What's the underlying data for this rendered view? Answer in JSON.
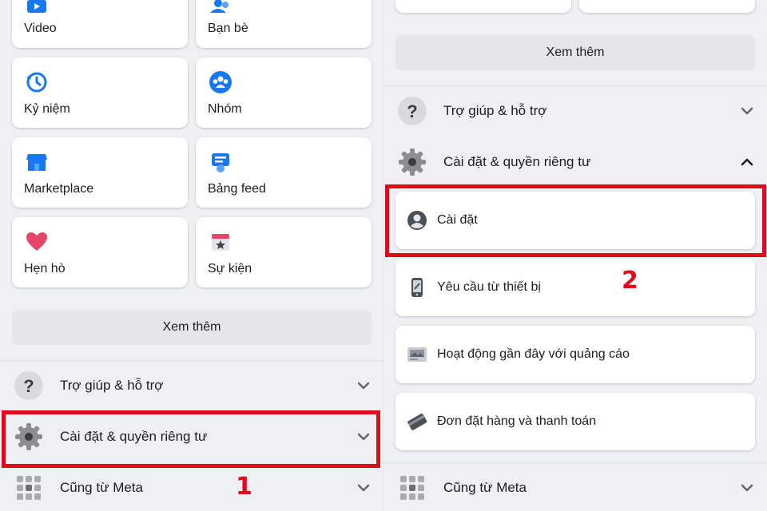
{
  "left": {
    "shortcuts": [
      {
        "label": "Video",
        "icon": "video-icon"
      },
      {
        "label": "Bạn bè",
        "icon": "friends-icon"
      },
      {
        "label": "Kỷ niệm",
        "icon": "memories-icon"
      },
      {
        "label": "Nhóm",
        "icon": "groups-icon"
      },
      {
        "label": "Marketplace",
        "icon": "marketplace-icon"
      },
      {
        "label": "Bảng feed",
        "icon": "feed-icon"
      },
      {
        "label": "Hẹn hò",
        "icon": "dating-icon"
      },
      {
        "label": "Sự kiện",
        "icon": "events-icon"
      }
    ],
    "see_more": "Xem thêm",
    "menu": [
      {
        "label": "Trợ giúp & hỗ trợ",
        "icon": "help-icon"
      },
      {
        "label": "Cài đặt & quyền riêng tư",
        "icon": "gear-icon"
      },
      {
        "label": "Cũng từ Meta",
        "icon": "meta-apps-icon"
      }
    ],
    "step_marker": "1"
  },
  "right": {
    "see_more": "Xem thêm",
    "menu": [
      {
        "label": "Trợ giúp & hỗ trợ",
        "icon": "help-icon"
      },
      {
        "label": "Cài đặt & quyền riêng tư",
        "icon": "gear-icon"
      },
      {
        "label": "Cũng từ Meta",
        "icon": "meta-apps-icon"
      }
    ],
    "settings_items": [
      {
        "label": "Cài đặt",
        "icon": "profile-settings-icon"
      },
      {
        "label": "Yêu cầu từ thiết bị",
        "icon": "device-request-icon"
      },
      {
        "label": "Hoạt động gần đây với quảng cáo",
        "icon": "ad-activity-icon"
      },
      {
        "label": "Đơn đặt hàng và thanh toán",
        "icon": "payment-card-icon"
      }
    ],
    "step_marker": "2"
  },
  "colors": {
    "highlight": "#e00b1a",
    "facebook_blue": "#1877f2"
  }
}
